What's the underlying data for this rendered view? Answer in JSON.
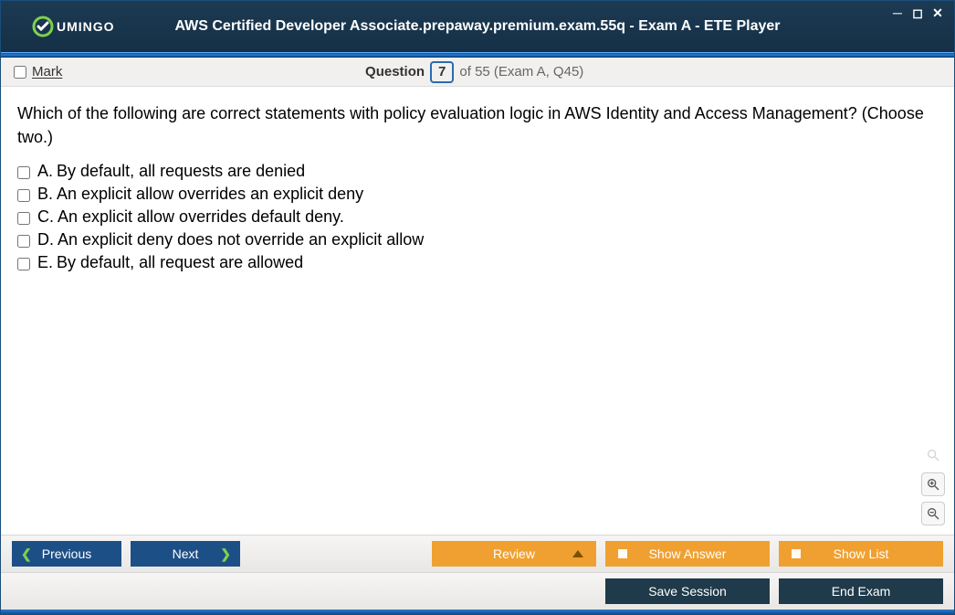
{
  "header": {
    "logo": "UMINGO",
    "title": "AWS Certified Developer Associate.prepaway.premium.exam.55q - Exam A - ETE Player"
  },
  "infobar": {
    "mark_label": "Mark",
    "question_word": "Question",
    "question_number": "7",
    "question_rest": "of 55 (Exam A, Q45)"
  },
  "question": {
    "text": "Which of the following are correct statements with policy evaluation logic in AWS Identity and Access Management? (Choose two.)",
    "answers": [
      {
        "letter": "A.",
        "text": "By default, all requests are denied"
      },
      {
        "letter": "B.",
        "text": "An explicit allow overrides an explicit deny"
      },
      {
        "letter": "C.",
        "text": "An explicit allow overrides default deny."
      },
      {
        "letter": "D.",
        "text": "An explicit deny does not override an explicit allow"
      },
      {
        "letter": "E.",
        "text": "By default, all request are allowed"
      }
    ]
  },
  "toolbar": {
    "previous": "Previous",
    "next": "Next",
    "review": "Review",
    "show_answer": "Show Answer",
    "show_list": "Show List",
    "save_session": "Save Session",
    "end_exam": "End Exam"
  }
}
